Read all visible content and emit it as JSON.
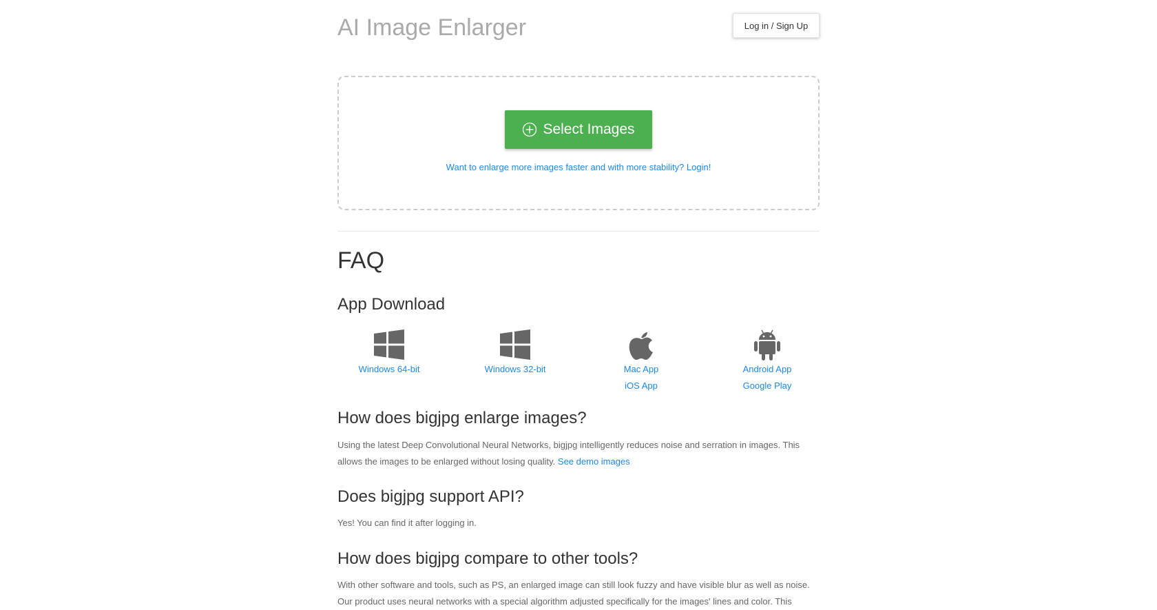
{
  "header": {
    "brand": "AI Image Enlarger",
    "login_label": "Log in / Sign Up"
  },
  "upload": {
    "select_label": "Select Images",
    "select_icon": "plus-circle-icon",
    "login_hint": "Want to enlarge more images faster and with more stability? Login!"
  },
  "faq": {
    "title": "FAQ",
    "app_download": {
      "heading": "App Download",
      "apps": [
        {
          "icon": "windows-icon",
          "links": [
            "Windows 64-bit"
          ]
        },
        {
          "icon": "windows-icon",
          "links": [
            "Windows 32-bit"
          ]
        },
        {
          "icon": "apple-icon",
          "links": [
            "Mac App",
            "iOS App"
          ]
        },
        {
          "icon": "android-icon",
          "links": [
            "Android App",
            "Google Play"
          ]
        }
      ]
    },
    "q1": {
      "heading": "How does bigjpg enlarge images?",
      "text": "Using the latest Deep Convolutional Neural Networks, bigjpg intelligently reduces noise and serration in images. This allows the images to be enlarged without losing quality.",
      "link": "See demo images"
    },
    "q2": {
      "heading": "Does bigjpg support API?",
      "text": "Yes! You can find it after logging in."
    },
    "q3": {
      "heading": "How does bigjpg compare to other tools?",
      "text": "With other software and tools, such as PS, an enlarged image can still look fuzzy and have visible blur as well as noise. Our product uses neural networks with a special algorithm adjusted specifically for the images' lines and color. This"
    }
  },
  "colors": {
    "accent_green": "#4caf50",
    "link_blue": "#1e88e5",
    "icon_gray": "#666666"
  }
}
